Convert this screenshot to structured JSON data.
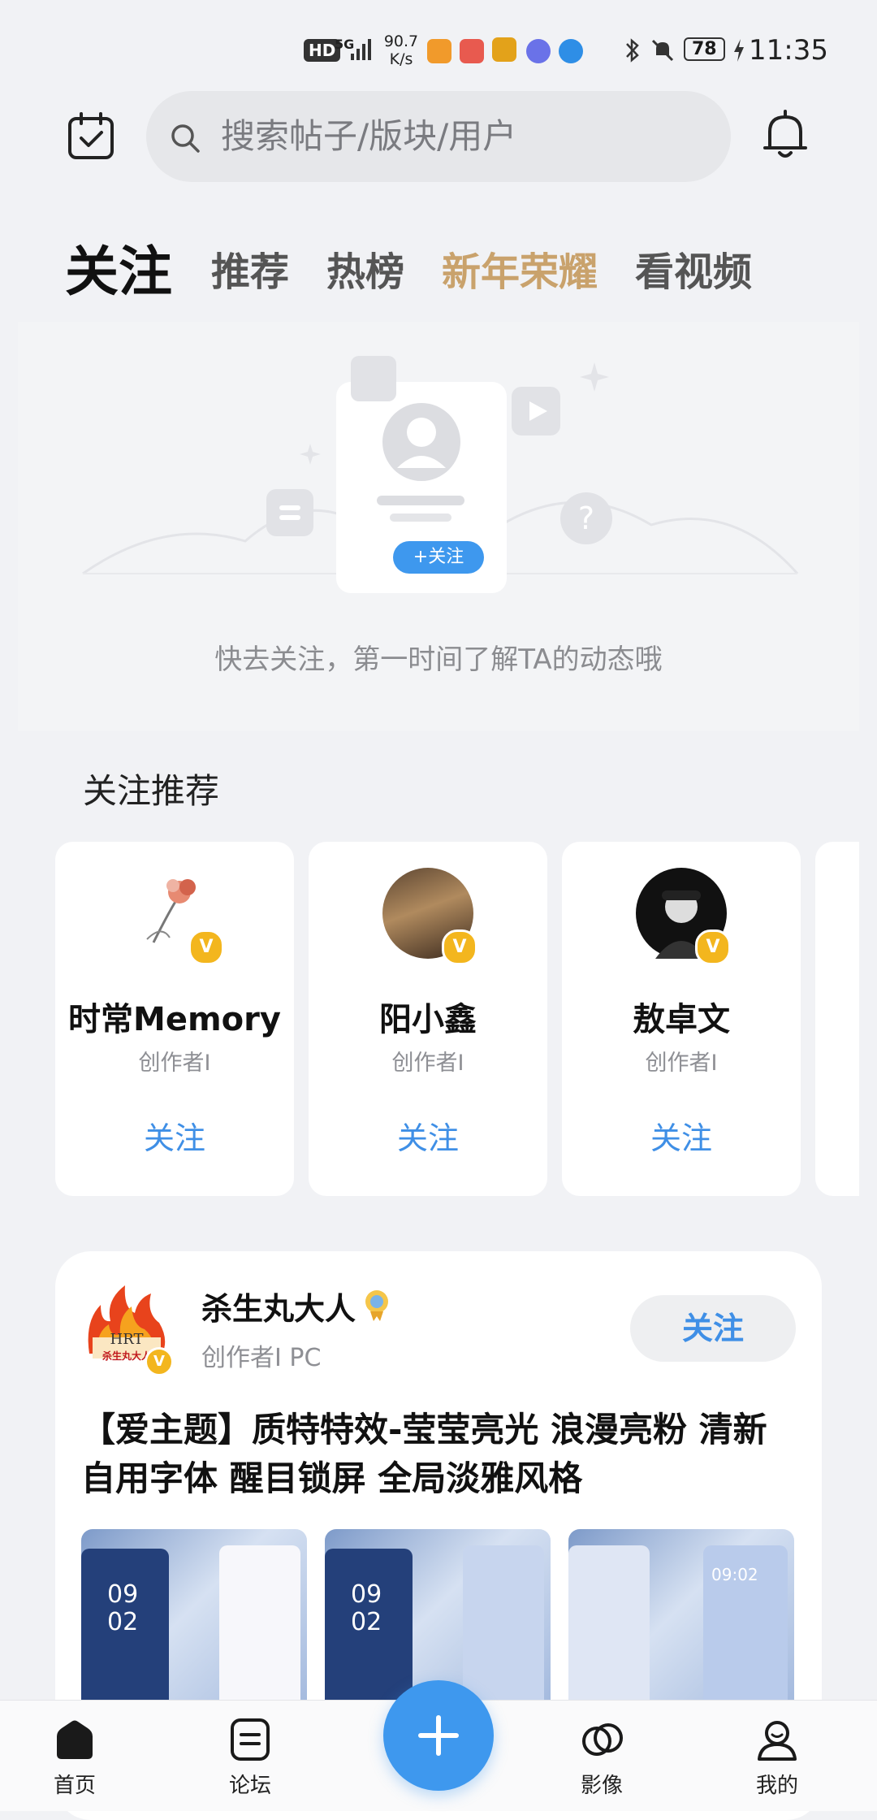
{
  "status_bar": {
    "hd": "HD",
    "network": "5G",
    "speed_value": "90.7",
    "speed_unit": "K/s",
    "battery": "78",
    "time": "11:35"
  },
  "header": {
    "search_placeholder": "搜索帖子/版块/用户",
    "checkin_icon": "calendar-check-icon",
    "bell_icon": "bell-icon"
  },
  "tabs": [
    {
      "label": "关注",
      "active": true
    },
    {
      "label": "推荐",
      "active": false
    },
    {
      "label": "热榜",
      "active": false
    },
    {
      "label": "新年荣耀",
      "active": false,
      "special": true
    },
    {
      "label": "看视频",
      "active": false
    }
  ],
  "empty_state": {
    "follow_chip": "+关注",
    "message": "快去关注，第一时间了解TA的动态哦"
  },
  "recommend": {
    "title": "关注推荐",
    "cards": [
      {
        "name": "时常Memory",
        "role": "创作者I",
        "follow": "关注"
      },
      {
        "name": "阳小鑫",
        "role": "创作者I",
        "follow": "关注"
      },
      {
        "name": "敖卓文",
        "role": "创作者I",
        "follow": "关注"
      }
    ]
  },
  "post": {
    "author": "杀生丸大人",
    "meta": "创作者I  PC",
    "follow": "关注",
    "avatar_text": "HRT",
    "avatar_subtext": "杀生丸大人",
    "title": "【爱主题】质特特效-莹莹亮光 浪漫亮粉 清新自用字体 醒目锁屏 全局淡雅风格",
    "thumbs": [
      {
        "time_line1": "09",
        "time_line2": "02"
      },
      {
        "time_line1": "09",
        "time_line2": "02"
      },
      {
        "time_line1": "09:02",
        "time_line2": ""
      }
    ]
  },
  "bottom_nav": [
    {
      "label": "首页",
      "icon": "home-icon"
    },
    {
      "label": "论坛",
      "icon": "forum-icon"
    },
    {
      "label": "影像",
      "icon": "camera-rings-icon"
    },
    {
      "label": "我的",
      "icon": "profile-icon"
    }
  ],
  "colors": {
    "accent_blue": "#3f8fe6",
    "gold_tab": "#c9a26c",
    "fab": "#3e98ee"
  }
}
